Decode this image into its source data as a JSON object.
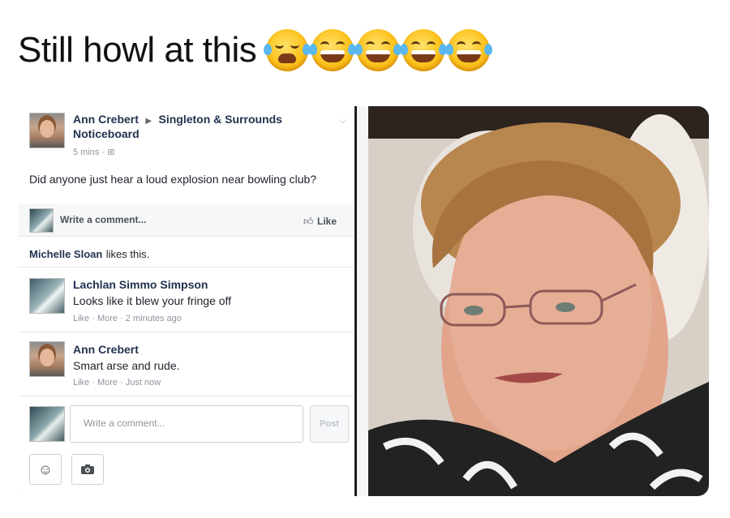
{
  "caption": {
    "text": "Still howl at this",
    "emojis": [
      "loudly-crying-face",
      "face-with-tears-of-joy",
      "face-with-tears-of-joy",
      "face-with-tears-of-joy",
      "face-with-tears-of-joy"
    ]
  },
  "post": {
    "author": "Ann Crebert",
    "group": "Singleton & Surrounds Noticeboard",
    "time": "5 mins",
    "body": "Did anyone just hear a loud explosion near bowling club?",
    "write_comment": "Write a comment...",
    "like_label": "Like"
  },
  "likes": {
    "name": "Michelle Sloan",
    "suffix": "likes this."
  },
  "comments": [
    {
      "author": "Lachlan Simmo Simpson",
      "text": "Looks like it blew your fringe off",
      "actions": "Like · More · 2 minutes ago"
    },
    {
      "author": "Ann Crebert",
      "text": "Smart arse and rude.",
      "actions": "Like · More · Just now"
    }
  ],
  "composer": {
    "placeholder": "Write a comment...",
    "post_label": "Post"
  },
  "colors": {
    "fb_name": "#23324f",
    "fb_link": "#4b4f56",
    "emoji_yellow": "#fcc21b"
  }
}
